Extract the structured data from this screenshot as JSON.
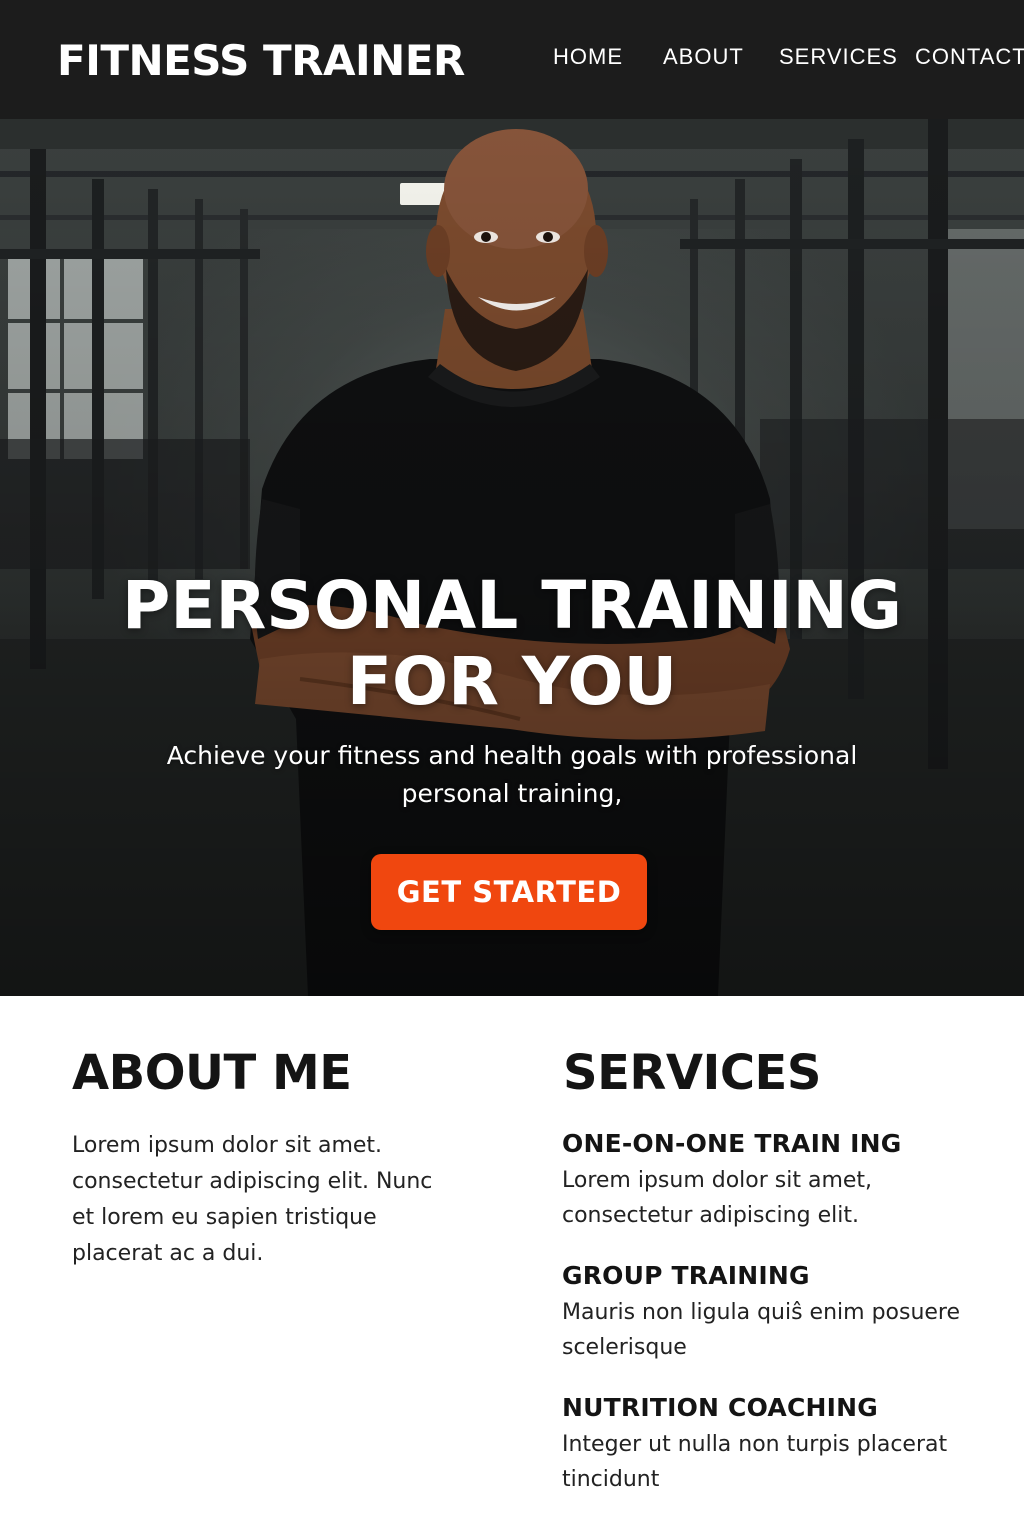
{
  "brand": "FITNESS TRAINER",
  "nav": {
    "home": "HOME",
    "about": "ABOUT",
    "services": "SERVICES",
    "contact": "CONTACT"
  },
  "hero": {
    "title_line1": "PERSONAL TRAINING",
    "title_line2": "FOR YOU",
    "subtitle": "Achieve your fitness and health goals with professional personal training,",
    "cta_label": "GET STARTED",
    "accent_color": "#f0470f"
  },
  "about": {
    "heading": "ABOUT ME",
    "body": "Lorem ipsum dolor sit amet. consectetur adipiscing elit. Nunc et lorem eu sapien tristique placerat ac a dui."
  },
  "services": {
    "heading": "SERVICES",
    "items": [
      {
        "title": "ONE-ON-ONE TRAIN ING",
        "description": "Lorem ipsum dolor sit amet, consectetur adipiscing elit."
      },
      {
        "title": "GROUP TRAINING",
        "description": "Mauris non ligula quiŝ  enim posuere scelerisque"
      },
      {
        "title": "NUTRITION COACHING",
        "description": "Integer ut nulla non turpis placerat tincidunt"
      }
    ]
  }
}
